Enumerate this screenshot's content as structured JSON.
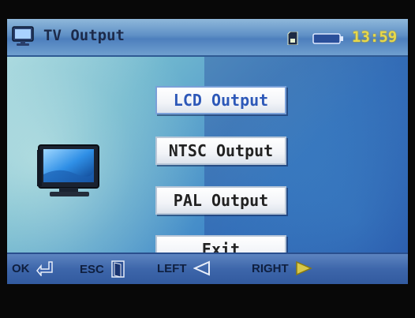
{
  "titlebar": {
    "title": "TV Output",
    "clock": "13:59",
    "icons": {
      "app": "tv-monitor-icon",
      "sd": "sd-card-icon",
      "battery": "battery-icon"
    }
  },
  "menu": {
    "selected_index": 0,
    "items": [
      {
        "label": "LCD Output"
      },
      {
        "label": "NTSC Output"
      },
      {
        "label": "PAL Output"
      },
      {
        "label": "Exit"
      }
    ]
  },
  "footer": {
    "hints": [
      {
        "label": "OK",
        "icon": "enter-key-icon"
      },
      {
        "label": "ESC",
        "icon": "door-exit-icon"
      },
      {
        "label": "LEFT",
        "icon": "arrow-left-icon"
      },
      {
        "label": "RIGHT",
        "icon": "arrow-right-icon"
      }
    ]
  },
  "colors": {
    "title_bar": "#5f90c6",
    "clock": "#e8d84a",
    "selected_text": "#2d58b8",
    "footer_bar": "#3d66aa"
  }
}
